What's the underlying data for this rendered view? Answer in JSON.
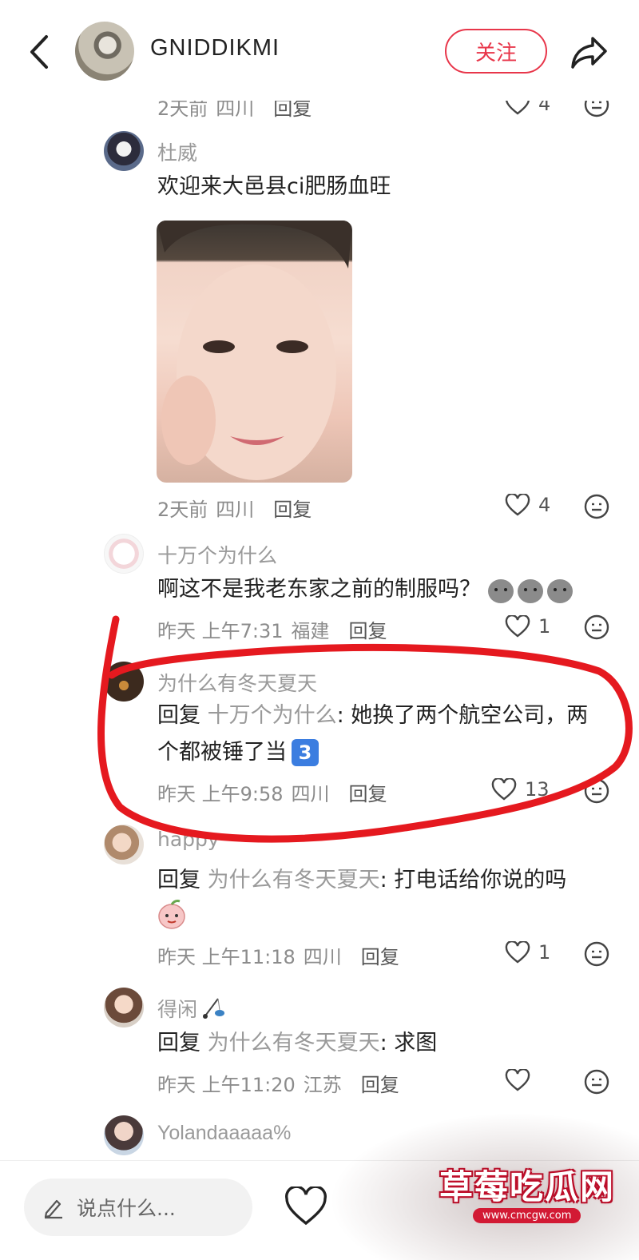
{
  "header": {
    "username": "GNIDDIKMI",
    "follow_label": "关注"
  },
  "comments": [
    {
      "time": "2天前",
      "region": "四川",
      "reply_label": "回复",
      "likes": "4"
    },
    {
      "username": "杜威",
      "text": "欢迎来大邑县ci肥肠血旺",
      "has_photo": true,
      "time": "2天前",
      "region": "四川",
      "reply_label": "回复",
      "likes": "4"
    },
    {
      "username": "十万个为什么",
      "text": "啊这不是我老东家之前的制服吗？",
      "time": "昨天 上午7:31",
      "region": "福建",
      "reply_label": "回复",
      "likes": "1"
    },
    {
      "username": "为什么有冬天夏天",
      "reply_prefix": "回复",
      "reply_to": "十万个为什么",
      "text_line1": ": 她换了两个航空公司，两",
      "text_line2": "个都被锤了当",
      "badge": "3",
      "time": "昨天 上午9:58",
      "region": "四川",
      "reply_label": "回复",
      "likes": "13"
    },
    {
      "username": "happy",
      "reply_prefix": "回复",
      "reply_to": "为什么有冬天夏天",
      "text": ": 打电话给你说的吗",
      "time": "昨天 上午11:18",
      "region": "四川",
      "reply_label": "回复",
      "likes": "1"
    },
    {
      "username": "得闲",
      "reply_prefix": "回复",
      "reply_to": "为什么有冬天夏天",
      "text": ": 求图",
      "time": "昨天 上午11:20",
      "region": "江苏",
      "reply_label": "回复",
      "likes": ""
    },
    {
      "username": "Yolandaaaaa%"
    }
  ],
  "bottom_bar": {
    "input_placeholder": "说点什么..."
  },
  "watermark": {
    "text": "草莓吃瓜网",
    "url": "www.cmcgw.com"
  },
  "colors": {
    "accent": "#e8364a",
    "annotation_red": "#e5191f"
  }
}
